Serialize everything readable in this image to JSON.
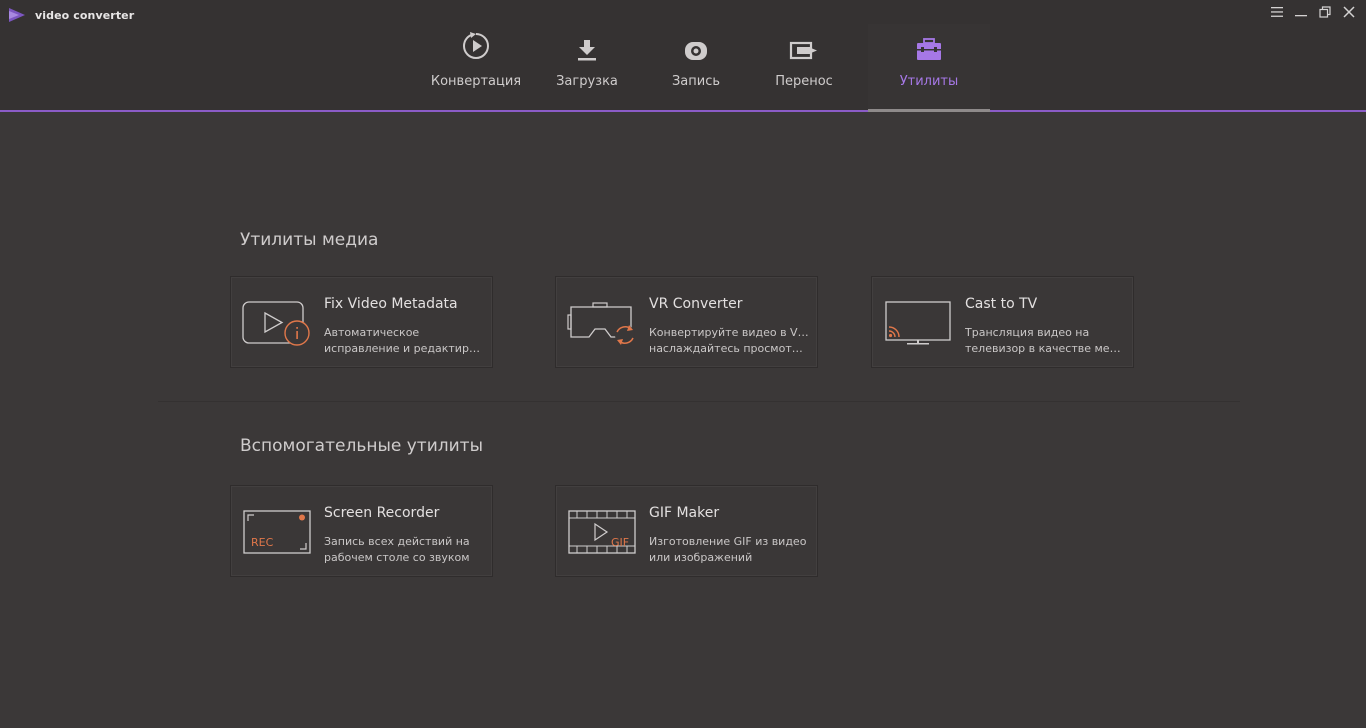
{
  "app": {
    "title": "video converter",
    "accent_color": "#8b5cc7",
    "highlight_color": "#e0774a"
  },
  "window_controls": [
    "menu-icon",
    "minimize-icon",
    "restore-icon",
    "close-icon"
  ],
  "nav": {
    "items": [
      {
        "label": "Конвертация",
        "icon": "convert-icon",
        "active": false
      },
      {
        "label": "Загрузка",
        "icon": "download-icon",
        "active": false
      },
      {
        "label": "Запись",
        "icon": "record-icon",
        "active": false
      },
      {
        "label": "Перенос",
        "icon": "transfer-icon",
        "active": false
      },
      {
        "label": "Утилиты",
        "icon": "toolbox-icon",
        "active": true
      }
    ]
  },
  "sections": [
    {
      "title": "Утилиты медиа",
      "cards": [
        {
          "title": "Fix Video Metadata",
          "desc1": "Автоматическое",
          "desc2": "исправление и редактиров...",
          "icon": "video-info-icon"
        },
        {
          "title": "VR Converter",
          "desc1": "Конвертируйте видео в VR и",
          "desc2": "наслаждайтесь просмотро...",
          "icon": "vr-headset-icon"
        },
        {
          "title": "Cast to TV",
          "desc1": "Трансляция видео на",
          "desc2": "телевизор в качестве меди...",
          "icon": "cast-tv-icon"
        }
      ]
    },
    {
      "title": "Вспомогательные утилиты",
      "cards": [
        {
          "title": "Screen Recorder",
          "desc1": "Запись всех действий на",
          "desc2": "рабочем столе со звуком",
          "icon": "screen-rec-icon",
          "badge": "REC"
        },
        {
          "title": "GIF Maker",
          "desc1": "Изготовление GIF из видео",
          "desc2": "или изображений",
          "icon": "gif-film-icon",
          "badge": "GIF"
        }
      ]
    }
  ]
}
